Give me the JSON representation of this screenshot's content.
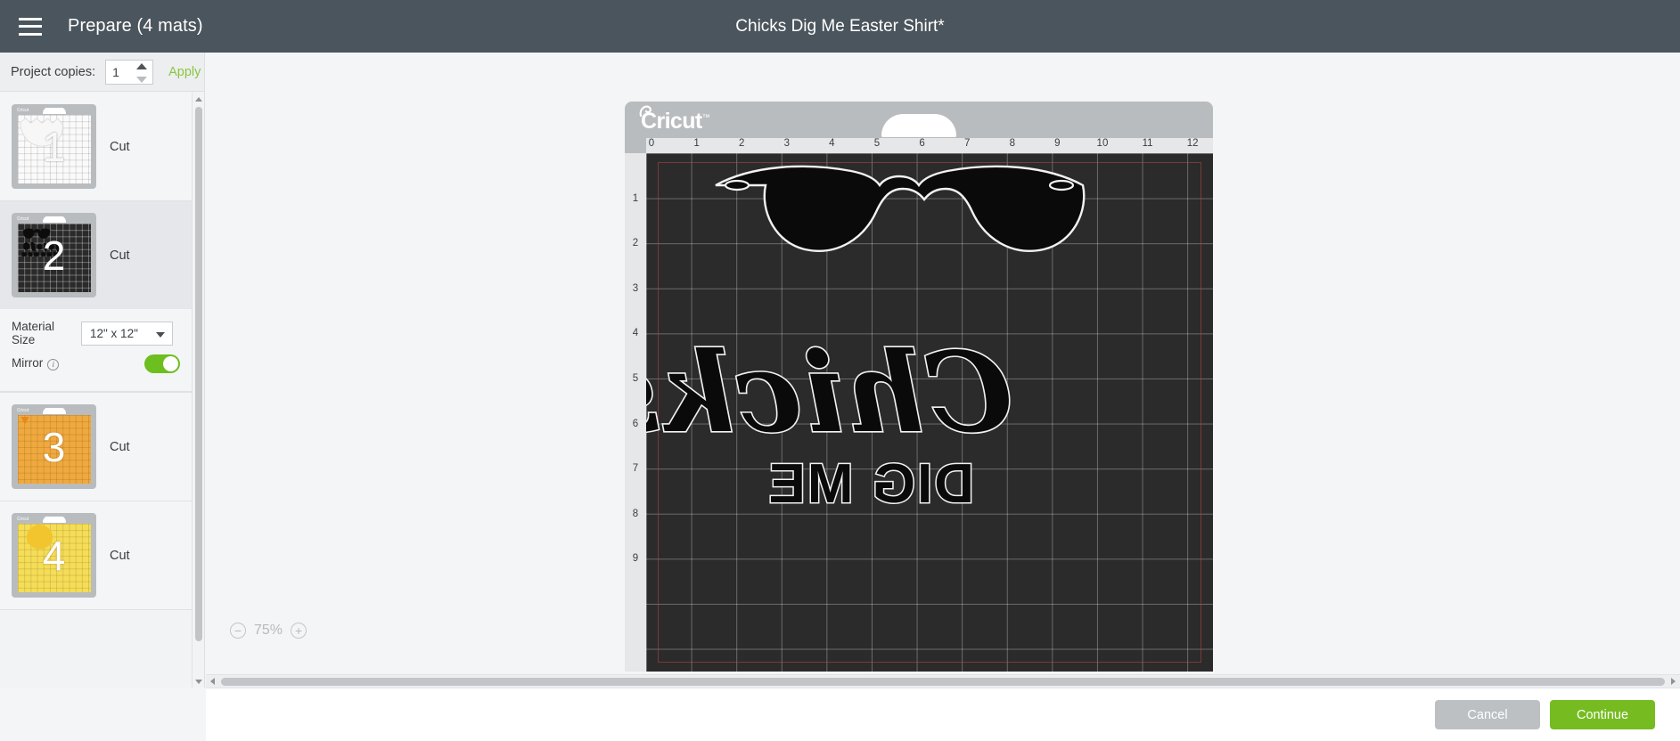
{
  "topbar": {
    "menu_icon": "hamburger-icon",
    "prepare_title": "Prepare (4 mats)",
    "document_title": "Chicks Dig Me Easter Shirt*"
  },
  "copies": {
    "label": "Project copies:",
    "value": "1",
    "apply_label": "Apply"
  },
  "mats": [
    {
      "number": "1",
      "action_label": "Cut",
      "color": "light",
      "selected": false,
      "art": "chick-shell"
    },
    {
      "number": "2",
      "action_label": "Cut",
      "color": "dark",
      "selected": true,
      "art": "sunglasses-text"
    },
    {
      "number": "3",
      "action_label": "Cut",
      "color": "orange",
      "selected": false,
      "art": "beak"
    },
    {
      "number": "4",
      "action_label": "Cut",
      "color": "yellow",
      "selected": false,
      "art": "chick"
    }
  ],
  "options": {
    "material_size_label": "Material Size",
    "material_size_value": "12\" x 12\"",
    "mirror_label": "Mirror",
    "mirror_info_icon": "info-icon",
    "mirror_on": true
  },
  "canvas": {
    "brand": "Cricut",
    "brand_tm": "™",
    "ruler_x": [
      "0",
      "1",
      "2",
      "3",
      "4",
      "5",
      "6",
      "7",
      "8",
      "9",
      "10",
      "11",
      "12"
    ],
    "ruler_y": [
      "1",
      "2",
      "3",
      "4",
      "5",
      "6",
      "7",
      "8",
      "9"
    ],
    "zoom_level": "75%",
    "zoom_out_icon": "minus-circle-icon",
    "zoom_in_icon": "plus-circle-icon",
    "design_text_line1": "Chicks",
    "design_text_line2": "DIG ME",
    "design_shape": "sunglasses"
  },
  "footer": {
    "cancel_label": "Cancel",
    "continue_label": "Continue"
  },
  "colors": {
    "topbar": "#4b555d",
    "accent_green": "#76bc21",
    "apply_green": "#8bc63f",
    "toggle_green": "#6cbf1f",
    "mat_orange": "#f0a93e",
    "mat_yellow": "#f5dd58"
  }
}
